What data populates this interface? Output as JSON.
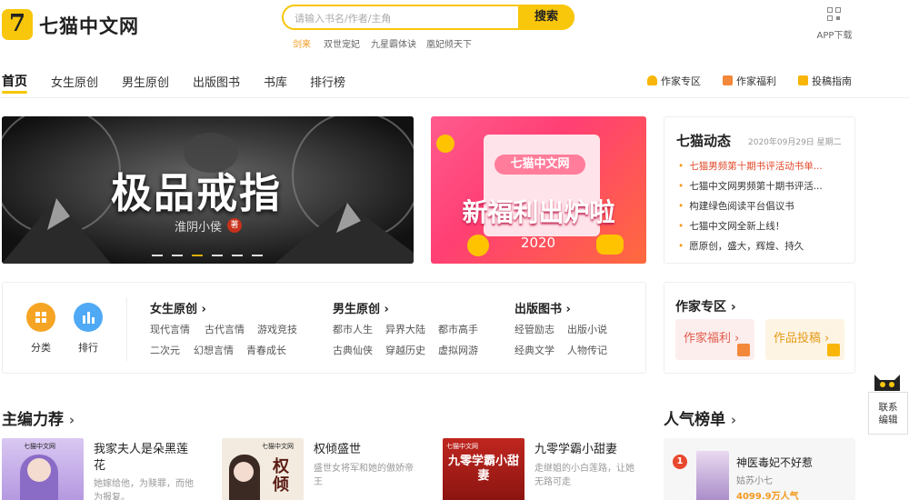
{
  "header": {
    "logo_mark": "7",
    "logo_text": "七猫中文网",
    "search_placeholder": "请输入书名/作者/主角",
    "search_button": "搜索",
    "hot_searches": [
      "剑来",
      "双世宠妃",
      "九星霸体诀",
      "凰妃倾天下"
    ],
    "app_download": "APP下载"
  },
  "nav": {
    "items": [
      "首页",
      "女生原创",
      "男生原创",
      "出版图书",
      "书库",
      "排行榜"
    ],
    "right_items": [
      "作家专区",
      "作家福利",
      "投稿指南"
    ]
  },
  "banner_main": {
    "title": "极品戒指",
    "author": "淮阴小侯",
    "badge": "著"
  },
  "banner_promo": {
    "brand": "七猫中文网",
    "headline": "新福利出炉啦",
    "year": "2020"
  },
  "news": {
    "title": "七猫动态",
    "date": "2020年09月29日 星期二",
    "items": [
      "七猫男频第十期书评活动书单...",
      "七猫中文网男频第十期书评活...",
      "构建绿色阅读平台倡议书",
      "七猫中文网全新上线！",
      "愿原创，盛大，辉煌、持久"
    ]
  },
  "categories": {
    "shortcuts": [
      "分类",
      "排行"
    ],
    "groups": [
      {
        "name": "女生原创",
        "links": [
          "现代言情",
          "古代言情",
          "游戏竞技",
          "二次元",
          "幻想言情",
          "青春成长"
        ]
      },
      {
        "name": "男生原创",
        "links": [
          "都市人生",
          "异界大陆",
          "都市高手",
          "古典仙侠",
          "穿越历史",
          "虚拟网游"
        ]
      },
      {
        "name": "出版图书",
        "links": [
          "经管励志",
          "出版小说",
          "经典文学",
          "人物传记"
        ]
      }
    ]
  },
  "author_zone": {
    "title": "作家专区",
    "welfare": "作家福利",
    "submit": "作品投稿"
  },
  "editor_picks": {
    "title": "主编力荐",
    "books": [
      {
        "title": "我家夫人是朵黑莲花",
        "desc": "她嫁给他，为赎罪，而他为报复。",
        "cover_text": ""
      },
      {
        "title": "权倾盛世",
        "desc": "盛世女将军和她的傲娇帝王",
        "cover_text": "权倾"
      },
      {
        "title": "九零学霸小甜妻",
        "desc": "走继姐的小白莲路，让她无路可走",
        "cover_text": "九零学霸小甜妻"
      }
    ],
    "cover_brand": "七猫中文网"
  },
  "popular": {
    "title": "人气榜单",
    "first": {
      "rank": "1",
      "title": "神医毒妃不好惹",
      "author": "姑苏小七",
      "heat": "4099.9万人气"
    }
  },
  "side_float": {
    "label": "联系编辑"
  },
  "colors": {
    "brand_yellow": "#f8c60a",
    "orange": "#f39a1f",
    "red": "#e14a2a"
  }
}
